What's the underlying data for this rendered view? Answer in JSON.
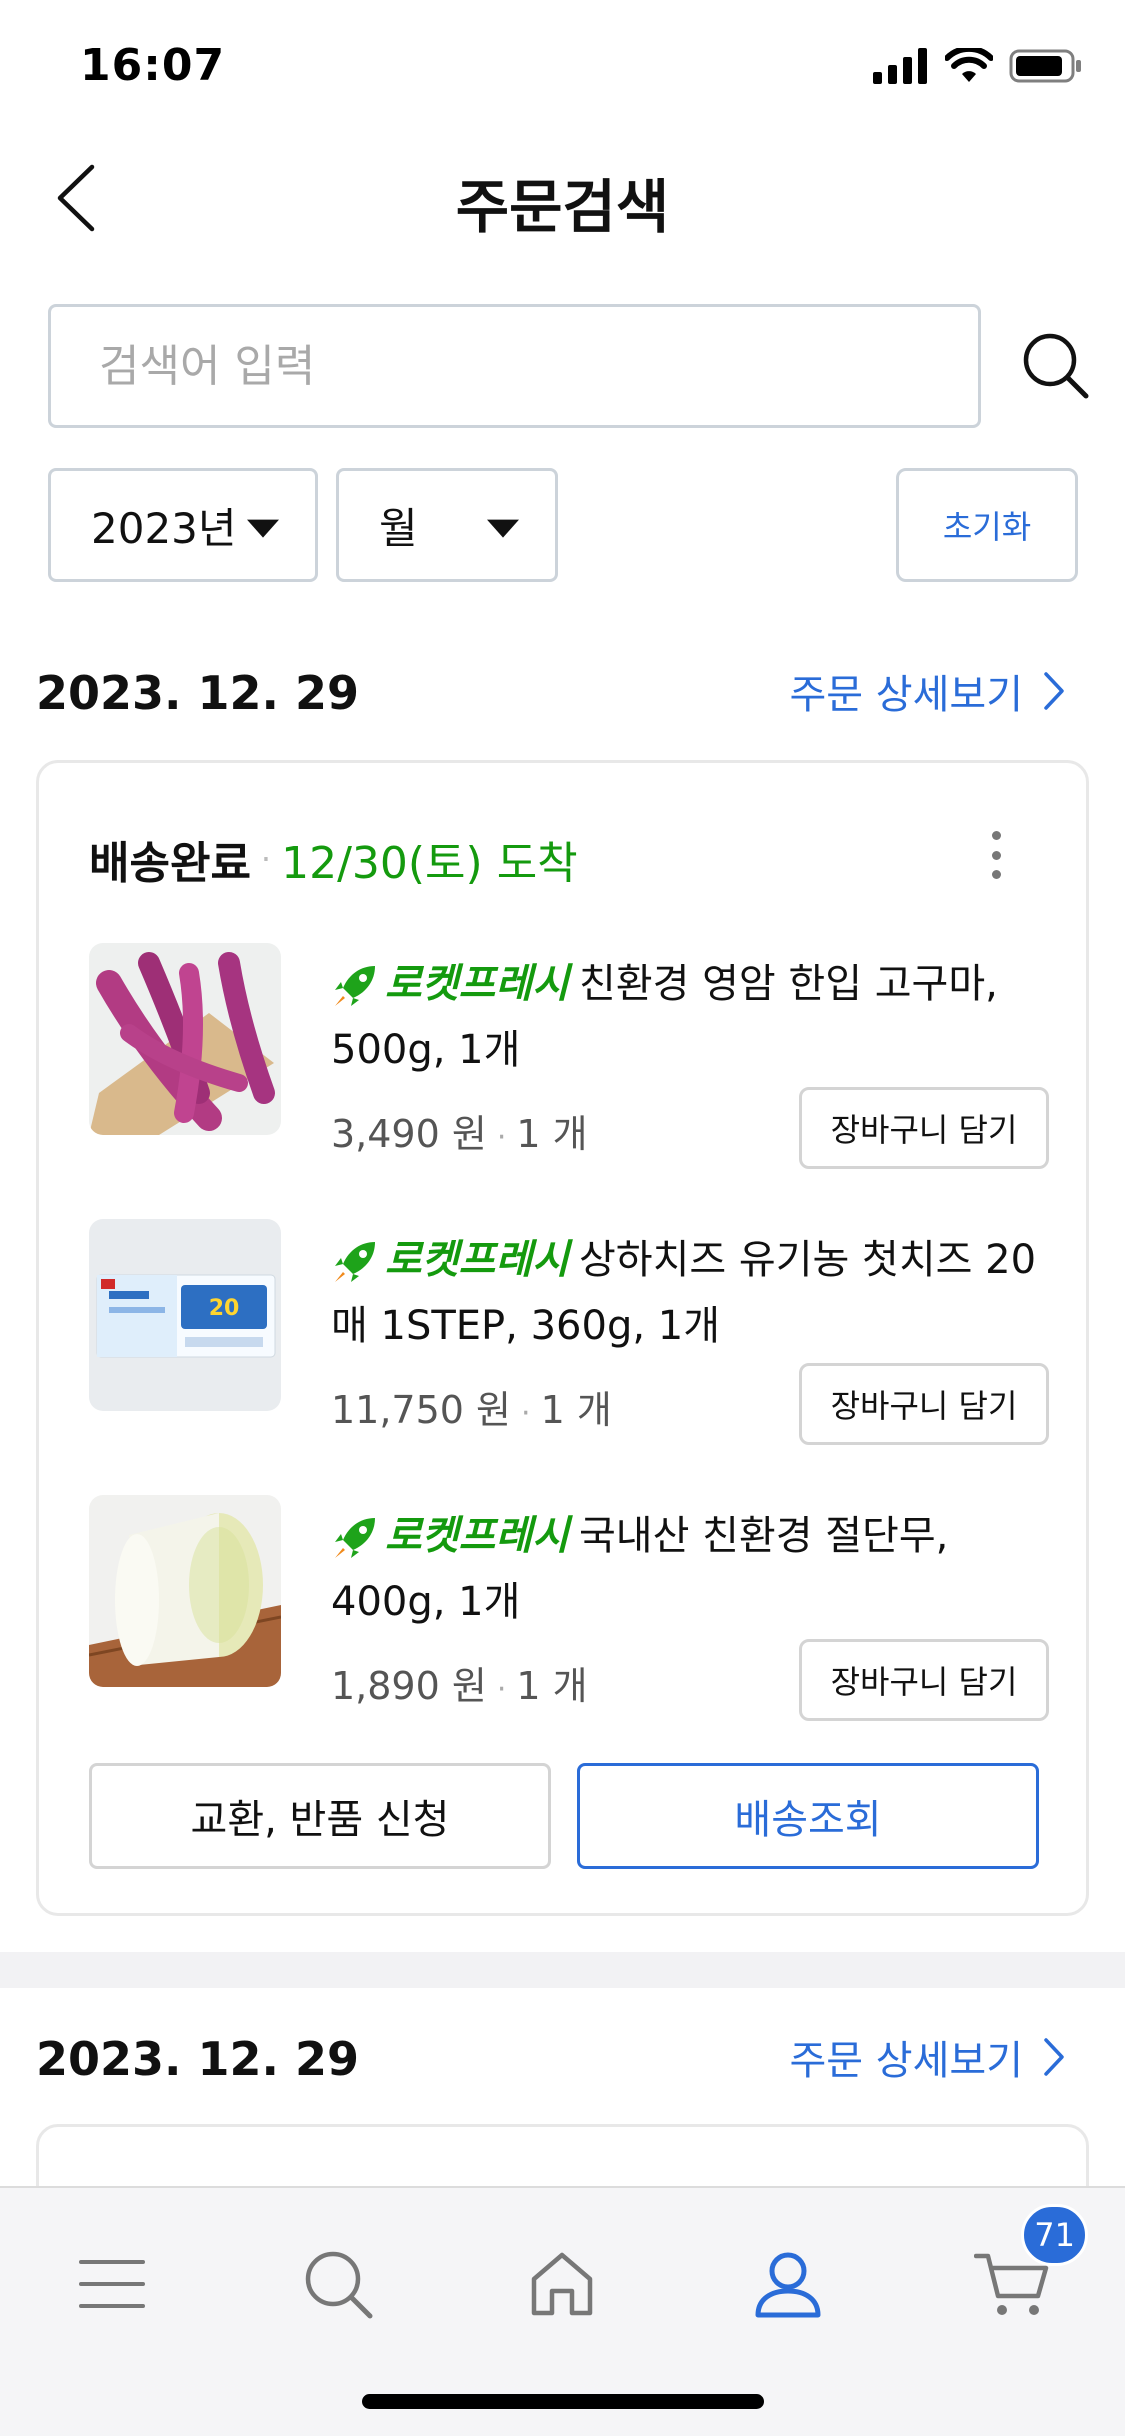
{
  "status_bar": {
    "time": "16:07",
    "battery_level": 0.8
  },
  "header": {
    "title": "주문검색",
    "back_icon": "chevron-left-icon"
  },
  "search": {
    "placeholder": "검색어 입력",
    "value": "",
    "icon": "search-icon"
  },
  "filters": {
    "year": "2023년",
    "month": "월",
    "reset_label": "초기화"
  },
  "orders": [
    {
      "date": "2023. 12. 29",
      "detail_link": "주문 상세보기",
      "status": "배송완료",
      "arrival": "12/30(토) 도착",
      "items": [
        {
          "badge": "로켓프레시",
          "title": "친환경 영암 한입 고구마, 500g, 1개",
          "price": "3,490 원",
          "qty": "1 개",
          "cart_label": "장바구니 담기"
        },
        {
          "badge": "로켓프레시",
          "title": "상하치즈 유기농 첫치즈 20매 1STEP, 360g, 1개",
          "price": "11,750 원",
          "qty": "1 개",
          "cart_label": "장바구니 담기"
        },
        {
          "badge": "로켓프레시",
          "title": "국내산 친환경 절단무, 400g, 1개",
          "price": "1,890 원",
          "qty": "1 개",
          "cart_label": "장바구니 담기"
        }
      ],
      "actions": {
        "return_label": "교환, 반품 신청",
        "track_label": "배송조회"
      }
    },
    {
      "date": "2023. 12. 29",
      "detail_link": "주문 상세보기"
    }
  ],
  "tab_bar": {
    "items": [
      "menu-icon",
      "search-icon",
      "home-icon",
      "my-page-icon",
      "cart-icon"
    ],
    "active": "my-page-icon",
    "cart_badge": "71"
  },
  "colors": {
    "accent": "#2a6cd8",
    "rocket_green": "#149a0e",
    "border": "#ccd3da"
  }
}
